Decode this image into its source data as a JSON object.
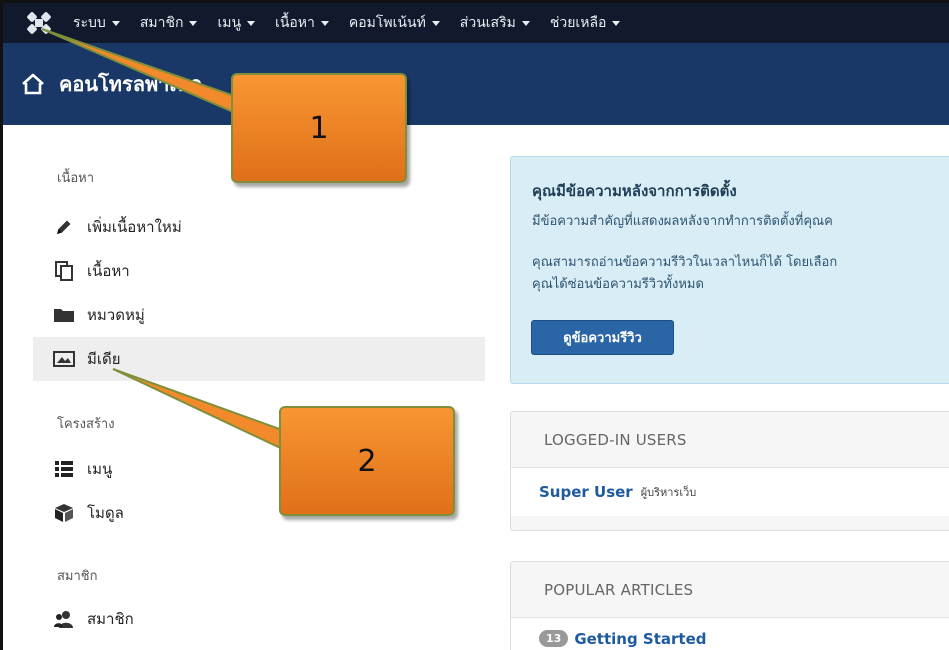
{
  "navbar": {
    "logo_icon": "joomla-logo-icon",
    "menu": [
      "ระบบ",
      "สมาชิก",
      "เมนู",
      "เนื้อหา",
      "คอมโพเน้นท์",
      "ส่วนเสริม",
      "ช่วยเหลือ"
    ]
  },
  "header": {
    "home_icon": "home-icon",
    "title": "คอนโทรลพาเนล"
  },
  "sidebar": {
    "sections": [
      {
        "title": "เนื้อหา",
        "items": [
          {
            "label": "เพิ่มเนื้อหาใหม่",
            "icon": "pencil-icon"
          },
          {
            "label": "เนื้อหา",
            "icon": "copy-icon"
          },
          {
            "label": "หมวดหมู่",
            "icon": "folder-icon"
          },
          {
            "label": "มีเดีย",
            "icon": "image-icon",
            "active": true
          }
        ]
      },
      {
        "title": "โครงสร้าง",
        "items": [
          {
            "label": "เมนู",
            "icon": "list-icon"
          },
          {
            "label": "โมดูล",
            "icon": "cube-icon"
          }
        ]
      },
      {
        "title": "สมาชิก",
        "items": [
          {
            "label": "สมาชิก",
            "icon": "users-icon"
          }
        ]
      }
    ]
  },
  "alert": {
    "title": "คุณมีข้อความหลังจากการติดตั้ง",
    "line1": "มีข้อความสำคัญที่แสดงผลหลังจากทำการติดตั้งที่คุณค",
    "line2": "คุณสามารถอ่านข้อความรีวิวในเวลาไหนก็ได้ โดยเลือก",
    "line3": "คุณได้ซ่อนข้อความรีวิวทั้งหมด",
    "button": "ดูข้อความรีวิว",
    "bg_color": "#d9edf7"
  },
  "logged_in": {
    "header": "LOGGED-IN USERS",
    "user": "Super User",
    "role": "ผู้บริหารเว็บ"
  },
  "popular": {
    "header": "POPULAR ARTICLES",
    "count": "13",
    "article": "Getting Started"
  },
  "callouts": [
    "1",
    "2"
  ],
  "colors": {
    "navbar": "#101a2c",
    "header": "#1a3867",
    "callout": "#f7922f",
    "button": "#2a66a6"
  }
}
